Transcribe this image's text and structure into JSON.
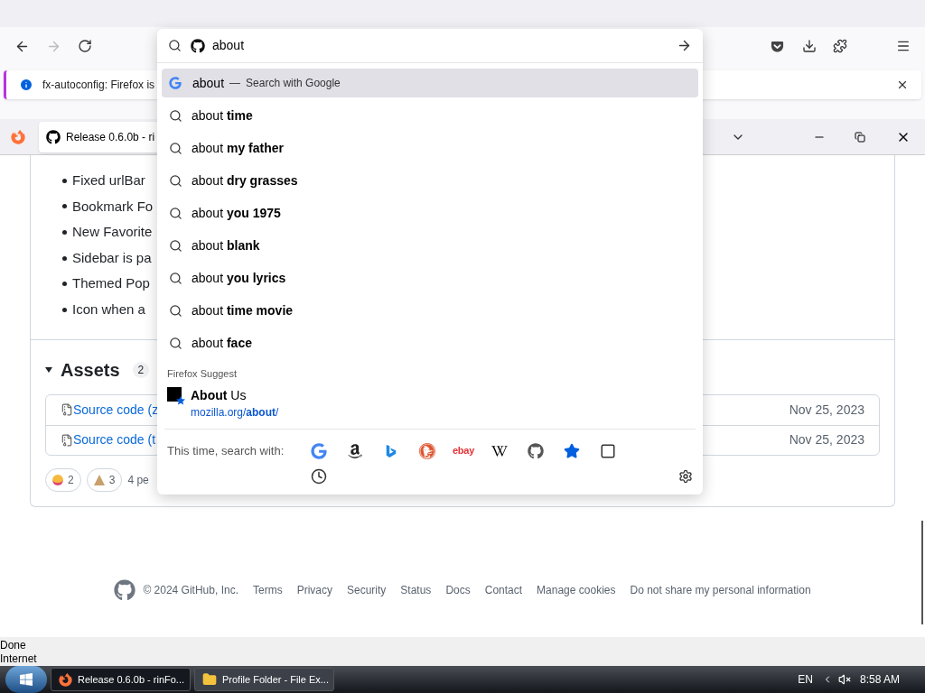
{
  "notification": {
    "text": "fx-autoconfig: Firefox is"
  },
  "tab": {
    "title": "Release 0.6.0b - ri",
    "selected": true
  },
  "release_notes": {
    "items": [
      "Fixed urlBar",
      "Bookmark Fo",
      "New Favorite",
      "Sidebar is pa",
      "Themed Pop",
      "Icon when a"
    ]
  },
  "assets": {
    "title": "Assets",
    "count": "2",
    "expanded": true,
    "files": [
      {
        "name": "Source code (z",
        "date": "Nov 25, 2023"
      },
      {
        "name": "Source code (t",
        "date": "Nov 25, 2023"
      }
    ]
  },
  "reactions": [
    {
      "kind": "laugh",
      "count": "2"
    },
    {
      "kind": "hooray",
      "count": "3"
    }
  ],
  "reactions_summary": "4 pe",
  "footer": {
    "copyright": "© 2024 GitHub, Inc.",
    "links": [
      "Terms",
      "Privacy",
      "Security",
      "Status",
      "Docs",
      "Contact",
      "Manage cookies",
      "Do not share my personal information"
    ]
  },
  "status_bar": [
    "Done",
    "Internet"
  ],
  "taskbar": {
    "items": [
      {
        "kind": "browser",
        "label": "Release 0.6.0b - rinFo...",
        "selected": true
      },
      {
        "kind": "folder",
        "label": "Profile Folder - File Ex...",
        "selected": false
      }
    ],
    "language": "EN",
    "time": "8:58 AM"
  },
  "urlbar": {
    "value": "about",
    "suggestions": [
      {
        "kind": "engine",
        "text": "about",
        "separator": "—",
        "action": "Search with Google",
        "selected": true
      },
      {
        "kind": "search",
        "text": "about **time**",
        "selected": false
      },
      {
        "kind": "search",
        "text": "about **my father**",
        "selected": false
      },
      {
        "kind": "search",
        "text": "about **dry grasses**",
        "selected": false
      },
      {
        "kind": "search",
        "text": "about **you 1975**",
        "selected": false
      },
      {
        "kind": "search",
        "text": "about **blank**",
        "selected": false
      },
      {
        "kind": "search",
        "text": "about **you lyrics**",
        "selected": false
      },
      {
        "kind": "search",
        "text": "about **time movie**",
        "selected": false
      },
      {
        "kind": "search",
        "text": "about **face**",
        "selected": false
      }
    ],
    "suggest_header": "Firefox Suggest",
    "suggest": {
      "title": "**About** Us",
      "url": "mozilla.org/**about**/"
    },
    "one_off_label": "This time, search with:",
    "one_offs": [
      {
        "kind": "google"
      },
      {
        "kind": "amazon"
      },
      {
        "kind": "bing"
      },
      {
        "kind": "duckduckgo"
      },
      {
        "kind": "ebay",
        "label": "ebay"
      },
      {
        "kind": "wikipedia"
      },
      {
        "kind": "github"
      },
      {
        "kind": "bookmarks"
      },
      {
        "kind": "tabs"
      },
      {
        "kind": "history"
      }
    ]
  }
}
